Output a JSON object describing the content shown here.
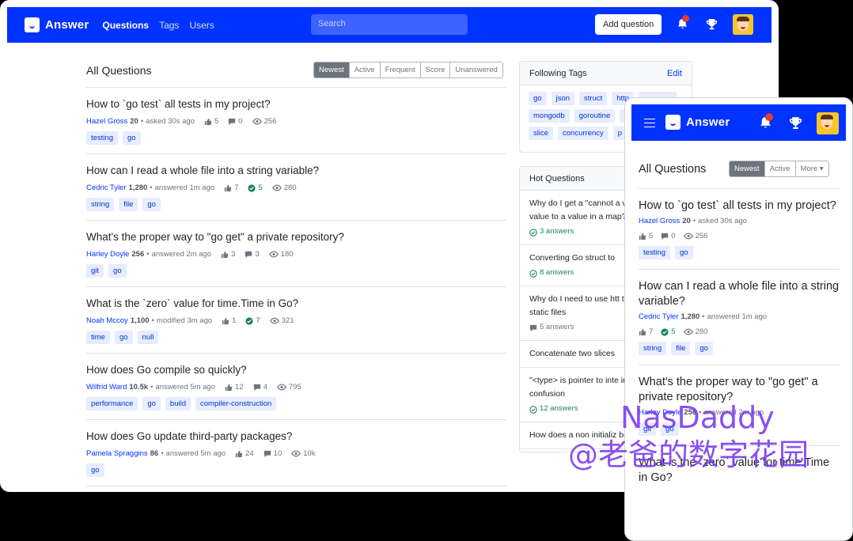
{
  "app": {
    "name": "Answer"
  },
  "nav": {
    "links": [
      "Questions",
      "Tags",
      "Users"
    ],
    "search_placeholder": "Search",
    "add_question": "Add question"
  },
  "list": {
    "title": "All Questions",
    "filters": [
      "Newest",
      "Active",
      "Frequent",
      "Score",
      "Unanswered"
    ],
    "questions": [
      {
        "title": "How to `go test` all tests in my project?",
        "user": "Hazel Gross",
        "rep": "20",
        "action": "asked 30s ago",
        "votes": "5",
        "answers": "0",
        "answered": false,
        "views": "256",
        "tags": [
          "testing",
          "go"
        ]
      },
      {
        "title": "How can I read a whole file into a string variable?",
        "user": "Cedric Tyler",
        "rep": "1,280",
        "action": "answered 1m ago",
        "votes": "7",
        "answers": "5",
        "answered": true,
        "views": "280",
        "tags": [
          "string",
          "file",
          "go"
        ]
      },
      {
        "title": "What's the proper way to \"go get\" a private repository?",
        "user": "Harley Doyle",
        "rep": "256",
        "action": "answered 2m ago",
        "votes": "3",
        "answers": "3",
        "answered": false,
        "views": "180",
        "tags": [
          "git",
          "go"
        ]
      },
      {
        "title": "What is the `zero` value for time.Time in Go?",
        "user": "Noah Mccoy",
        "rep": "1,100",
        "action": "modified 3m ago",
        "votes": "1",
        "answers": "7",
        "answered": true,
        "views": "321",
        "tags": [
          "time",
          "go",
          "null"
        ]
      },
      {
        "title": "How does Go compile so quickly?",
        "user": "Wilfrid Ward",
        "rep": "10.5k",
        "action": "answered 5m ago",
        "votes": "12",
        "answers": "4",
        "answered": false,
        "views": "795",
        "tags": [
          "performance",
          "go",
          "build",
          "compiler-construction"
        ]
      },
      {
        "title": "How does Go update third-party packages?",
        "user": "Pamela Spraggins",
        "rep": "86",
        "action": "answered 5m ago",
        "votes": "24",
        "answers": "10",
        "answered": false,
        "views": "10k",
        "tags": [
          "go"
        ]
      }
    ]
  },
  "following": {
    "title": "Following Tags",
    "edit": "Edit",
    "tags": [
      "go",
      "json",
      "struct",
      "http",
      "",
      "mongodb",
      "goroutine",
      "",
      "slice",
      "concurrency",
      "p"
    ]
  },
  "hot": {
    "title": "Hot Questions",
    "items": [
      {
        "text": "Why do I get a \"cannot a when setting value to a value in a map?",
        "answers": "3 answers",
        "ok": true
      },
      {
        "text": "Converting Go struct to",
        "answers": "8 answers",
        "ok": true
      },
      {
        "text": "Why do I need to use htt to access my static files",
        "answers": "5 answers",
        "ok": false
      },
      {
        "text": "Concatenate two slices",
        "answers": "",
        "ok": false
      },
      {
        "text": "\"<type> is pointer to inte interface\" confusion",
        "answers": "12 answers",
        "ok": true
      },
      {
        "text": "How does a non initializ behave?",
        "answers": "",
        "ok": false
      }
    ]
  },
  "mobile": {
    "title": "All Questions",
    "filters": [
      "Newest",
      "Active",
      "More"
    ],
    "questions": [
      {
        "title": "How to `go test` all tests in my project?",
        "user": "Hazel Gross",
        "rep": "20",
        "action": "asked 30s ago",
        "votes": "5",
        "answers": "0",
        "answered": false,
        "views": "256",
        "tags": [
          "testing",
          "go"
        ]
      },
      {
        "title": "How can I read a whole file into a string variable?",
        "user": "Cedric Tyler",
        "rep": "1,280",
        "action": "answered 1m ago",
        "votes": "7",
        "answers": "5",
        "answered": true,
        "views": "280",
        "tags": [
          "string",
          "file",
          "go"
        ]
      },
      {
        "title": "What's the proper way to \"go get\" a private repository?",
        "user": "Harley Doyle",
        "rep": "256",
        "action": "answered 2m ago",
        "votes": "",
        "answers": "",
        "answered": false,
        "views": "",
        "tags": [
          "git",
          "go"
        ]
      },
      {
        "title": "What is the `zero` value for time.Time in Go?",
        "user": "",
        "rep": "",
        "action": "",
        "votes": "",
        "answers": "",
        "answered": false,
        "views": "",
        "tags": []
      }
    ]
  },
  "watermark": {
    "line1": "NasDaddy",
    "line2": "@老爸的数字花园"
  },
  "colors": {
    "brand": "#0033ff",
    "tag_bg": "#e7edff",
    "success": "#198754",
    "watermark": "#7d3cf2"
  }
}
